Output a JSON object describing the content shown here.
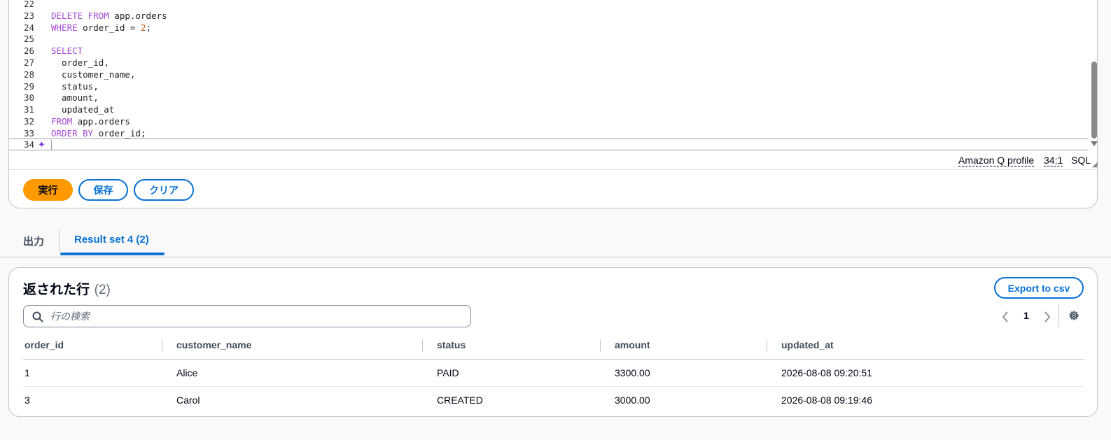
{
  "editor": {
    "lines": [
      {
        "n": "22",
        "parts": []
      },
      {
        "n": "23",
        "parts": [
          {
            "t": "DELETE FROM",
            "k": "kw"
          },
          {
            "t": " app.orders",
            "k": ""
          }
        ]
      },
      {
        "n": "24",
        "parts": [
          {
            "t": "WHERE",
            "k": "kw"
          },
          {
            "t": " order_id = ",
            "k": ""
          },
          {
            "t": "2",
            "k": "num"
          },
          {
            "t": ";",
            "k": ""
          }
        ]
      },
      {
        "n": "25",
        "parts": []
      },
      {
        "n": "26",
        "parts": [
          {
            "t": "SELECT",
            "k": "kw"
          }
        ]
      },
      {
        "n": "27",
        "parts": [
          {
            "t": "  order_id,",
            "k": ""
          }
        ]
      },
      {
        "n": "28",
        "parts": [
          {
            "t": "  customer_name,",
            "k": ""
          }
        ]
      },
      {
        "n": "29",
        "parts": [
          {
            "t": "  status,",
            "k": ""
          }
        ]
      },
      {
        "n": "30",
        "parts": [
          {
            "t": "  amount,",
            "k": ""
          }
        ]
      },
      {
        "n": "31",
        "parts": [
          {
            "t": "  updated_at",
            "k": ""
          }
        ]
      },
      {
        "n": "32",
        "parts": [
          {
            "t": "FROM",
            "k": "kw"
          },
          {
            "t": " app.orders",
            "k": ""
          }
        ]
      },
      {
        "n": "33",
        "parts": [
          {
            "t": "ORDER BY",
            "k": "kw"
          },
          {
            "t": " order_id;",
            "k": ""
          }
        ]
      }
    ],
    "current_line_number": "34",
    "sparkle_icon": "sparkle-icon"
  },
  "status_bar": {
    "profile": "Amazon Q profile",
    "position": "34:1",
    "language": "SQL"
  },
  "actions": {
    "run": "実行",
    "save": "保存",
    "clear": "クリア"
  },
  "tabs": {
    "output": "出力",
    "result": "Result set 4 (2)"
  },
  "results": {
    "title": "返された行",
    "count": "(2)",
    "export": "Export to csv",
    "search_placeholder": "行の検索",
    "page": "1",
    "columns": [
      "order_id",
      "customer_name",
      "status",
      "amount",
      "updated_at"
    ],
    "rows": [
      [
        "1",
        "Alice",
        "PAID",
        "3300.00",
        "2026-08-08 09:20:51"
      ],
      [
        "3",
        "Carol",
        "CREATED",
        "3000.00",
        "2026-08-08 09:19:46"
      ]
    ]
  },
  "colors": {
    "primary": "#ff9900",
    "link": "#0972d3",
    "keyword": "#a347d1",
    "number": "#c05621"
  }
}
